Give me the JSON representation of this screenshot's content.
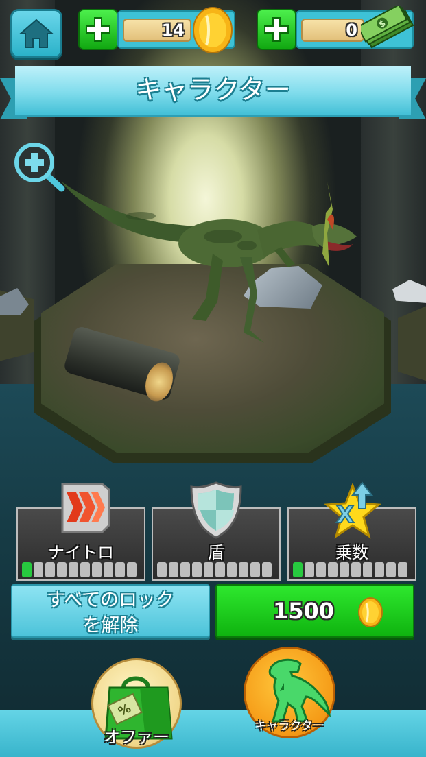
{
  "header": {
    "title": "キャラクター",
    "coins": "14",
    "cash": "0"
  },
  "stats": [
    {
      "label": "ナイトロ",
      "level": 1,
      "max": 10,
      "icon": "nitro-icon"
    },
    {
      "label": "盾",
      "level": 0,
      "max": 10,
      "icon": "shield-icon"
    },
    {
      "label": "乗数",
      "level": 1,
      "max": 10,
      "icon": "multiplier-icon"
    }
  ],
  "actions": {
    "unlock_all_label": "すべてのロック\nを解除",
    "unlock_line1": "すべてのロック",
    "unlock_line2": "を解除",
    "price": "1500"
  },
  "bottom_nav": {
    "offers_label": "オファー",
    "characters_label": "キャラクター"
  },
  "colors": {
    "accent_cyan": "#42bfd6",
    "accent_green": "#11b311",
    "meter_on": "#27c93f",
    "meter_off": "#bfbfbf"
  }
}
